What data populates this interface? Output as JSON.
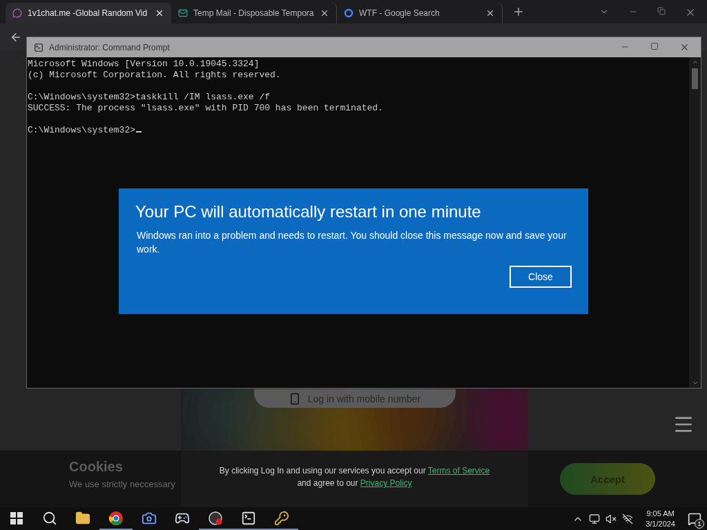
{
  "browser": {
    "tabs": [
      {
        "title": "1v1chat.me -Global Random Vid",
        "selected": true
      },
      {
        "title": "Temp Mail - Disposable Tempora",
        "selected": false
      },
      {
        "title": "WTF - Google Search",
        "selected": false
      }
    ]
  },
  "page": {
    "login_button": "Log in with mobile number",
    "cookie_banner": {
      "title": "Cookies",
      "text": "We use strictly neccessary",
      "accept": "Accept"
    },
    "consent": {
      "before": "By clicking Log In and using our services you accept our",
      "terms_link": "Terms of Service",
      "middle": "and agree to our",
      "privacy_link": "Privacy Policy"
    }
  },
  "console": {
    "title": "Administrator: Command Prompt",
    "blocks": [
      [
        "Microsoft Windows [Version 10.0.19045.3324]",
        "(c) Microsoft Corporation. All rights reserved."
      ],
      [
        "C:\\Windows\\system32>taskkill /IM lsass.exe /f",
        "SUCCESS: The process \"lsass.exe\" with PID 700 has been terminated."
      ],
      [
        "C:\\Windows\\system32>"
      ]
    ]
  },
  "dialog": {
    "title": "Your PC will automatically restart in one minute",
    "message": "Windows ran into a problem and needs to restart. You should close this message now and save your work.",
    "button": "Close"
  },
  "taskbar": {
    "apps": [
      {
        "kind": "explorer",
        "running": false
      },
      {
        "kind": "chrome",
        "running": true
      },
      {
        "kind": "camera",
        "running": false
      },
      {
        "kind": "steam",
        "running": false
      },
      {
        "kind": "obs",
        "running": true
      },
      {
        "kind": "terminal",
        "running": true
      },
      {
        "kind": "keys",
        "running": true
      }
    ],
    "time": "9:05 AM",
    "date": "3/1/2024",
    "notifications": "1"
  }
}
